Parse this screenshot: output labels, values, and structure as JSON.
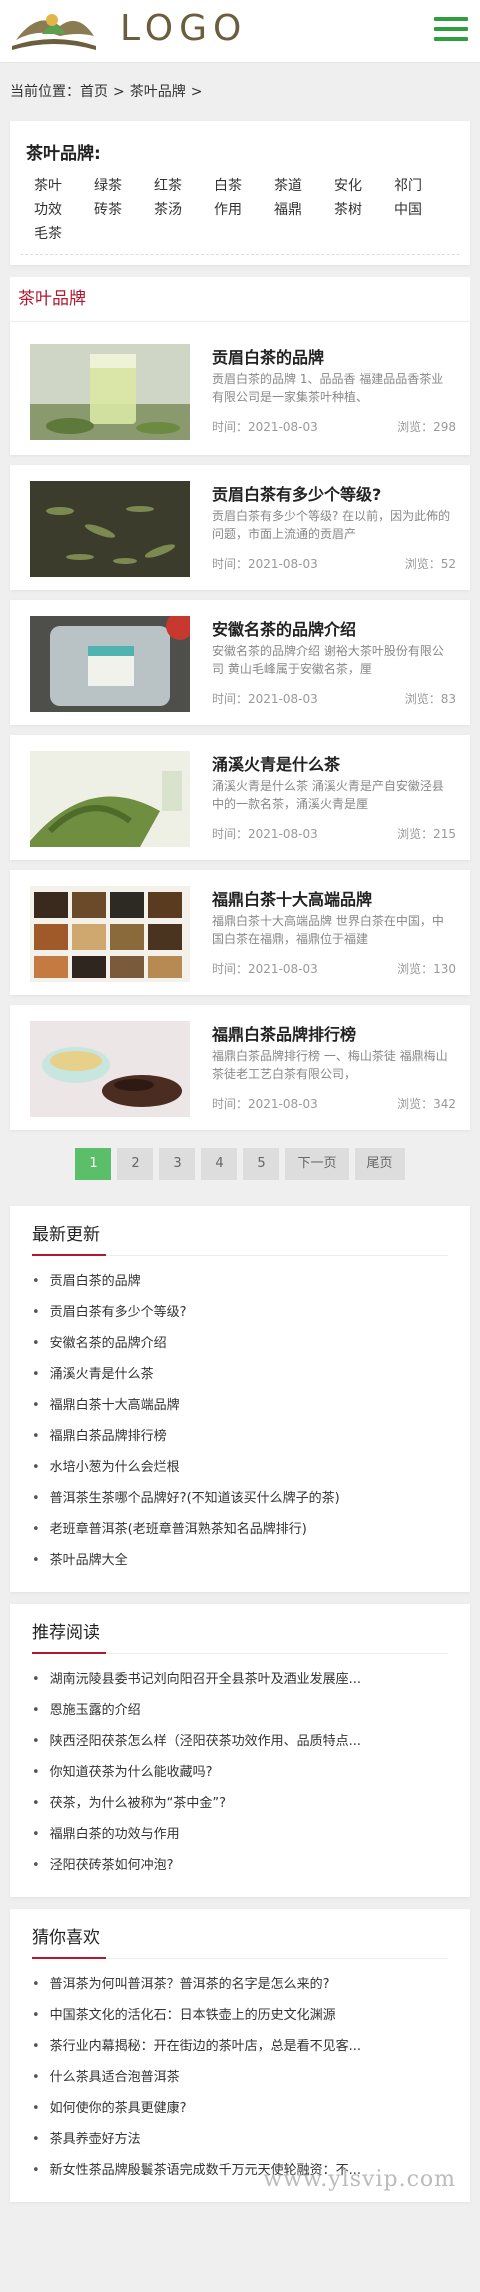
{
  "header": {
    "logo_text": "LOGO"
  },
  "breadcrumb": {
    "prefix": "当前位置：",
    "home": "首页",
    "sep": ">",
    "current": "茶叶品牌",
    "end": ">"
  },
  "tags": {
    "title": "茶叶品牌:",
    "items": [
      "茶叶",
      "绿茶",
      "红茶",
      "白茶",
      "茶道",
      "安化",
      "祁门",
      "功效",
      "砖茶",
      "茶汤",
      "作用",
      "福鼎",
      "茶树",
      "中国",
      "毛茶"
    ]
  },
  "section_title": "茶叶品牌",
  "articles": [
    {
      "title": "贡眉白茶的品牌",
      "desc": "贡眉白茶的品牌 1、品品香 福建品品香茶业有限公司是一家集茶叶种植、",
      "date": "时间：2021-08-03",
      "views": "浏览：298"
    },
    {
      "title": "贡眉白茶有多少个等级?",
      "desc": "贡眉白茶有多少个等级? 在以前，因为此佈的问题，市面上流通的贡眉产",
      "date": "时间：2021-08-03",
      "views": "浏览：52"
    },
    {
      "title": "安徽名茶的品牌介绍",
      "desc": "安徽名茶的品牌介绍 谢裕大茶叶股份有限公司 黄山毛峰属于安徽名茶，厘",
      "date": "时间：2021-08-03",
      "views": "浏览：83"
    },
    {
      "title": "涌溪火青是什么茶",
      "desc": "涌溪火青是什么茶 涌溪火青是产自安徽泾县中的一款名茶，涌溪火青是厘",
      "date": "时间：2021-08-03",
      "views": "浏览：215"
    },
    {
      "title": "福鼎白茶十大高端品牌",
      "desc": "福鼎白茶十大高端品牌 世界白茶在中国，中国白茶在福鼎，福鼎位于福建",
      "date": "时间：2021-08-03",
      "views": "浏览：130"
    },
    {
      "title": "福鼎白茶品牌排行榜",
      "desc": "福鼎白茶品牌排行榜 一、梅山茶徒 福鼎梅山茶徒老工艺白茶有限公司，",
      "date": "时间：2021-08-03",
      "views": "浏览：342"
    }
  ],
  "pager": {
    "pages": [
      "1",
      "2",
      "3",
      "4",
      "5"
    ],
    "next": "下一页",
    "last": "尾页",
    "current": "1"
  },
  "latest": {
    "title": "最新更新",
    "items": [
      "贡眉白茶的品牌",
      "贡眉白茶有多少个等级?",
      "安徽名茶的品牌介绍",
      "涌溪火青是什么茶",
      "福鼎白茶十大高端品牌",
      "福鼎白茶品牌排行榜",
      "水培小葱为什么会烂根",
      "普洱茶生茶哪个品牌好?(不知道该买什么牌子的茶)",
      "老班章普洱茶(老班章普洱熟茶知名品牌排行)",
      "茶叶品牌大全"
    ]
  },
  "recommend": {
    "title": "推荐阅读",
    "items": [
      "湖南沅陵县委书记刘向阳召开全县茶叶及酒业发展座...",
      "恩施玉露的介绍",
      "陕西泾阳茯茶怎么样（泾阳茯茶功效作用、品质特点...",
      "你知道茯茶为什么能收藏吗?",
      "茯茶，为什么被称为“茶中金”?",
      "福鼎白茶的功效与作用",
      "泾阳茯砖茶如何冲泡?"
    ]
  },
  "guess": {
    "title": "猜你喜欢",
    "items": [
      "普洱茶为何叫普洱茶？普洱茶的名字是怎么来的?",
      "中国茶文化的活化石：日本铁壶上的历史文化渊源",
      "茶行业内幕揭秘：开在街边的茶叶店，总是看不见客...",
      "什么茶具适合泡普洱茶",
      "如何使你的茶具更健康?",
      "茶具养壶好方法",
      "新女性茶品牌殷鬟茶语完成数千万元天使轮融资：不..."
    ]
  },
  "watermark": "www.ylsvip.com",
  "colors": {
    "accent": "#b2192f",
    "green": "#5bbf6a",
    "menu": "#2f9e3f"
  }
}
